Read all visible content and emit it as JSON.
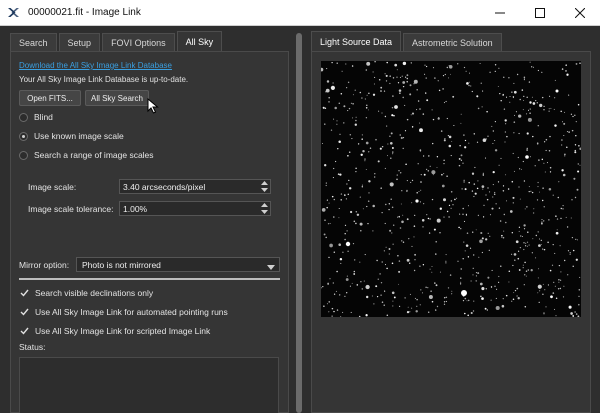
{
  "window": {
    "title": "00000021.fit - Image Link",
    "controls": [
      "—",
      "☐",
      "✕"
    ]
  },
  "left_tabs": [
    {
      "label": "Search",
      "active": false
    },
    {
      "label": "Setup",
      "active": false
    },
    {
      "label": "FOVI Options",
      "active": false
    },
    {
      "label": "All Sky",
      "active": true
    }
  ],
  "right_tabs": [
    {
      "label": "Light Source Data",
      "active": true
    },
    {
      "label": "Astrometric Solution",
      "active": false
    }
  ],
  "allsky": {
    "download_link": "Download the All Sky Image Link Database",
    "db_status": "Your All Sky Image Link Database is up-to-date.",
    "open_fits_button": "Open FITS...",
    "allsky_search_button": "All Sky Search"
  },
  "scale_mode": {
    "options": [
      {
        "label": "Blind",
        "checked": false
      },
      {
        "label": "Use known image scale",
        "checked": true
      },
      {
        "label": "Search a range of image scales",
        "checked": false
      }
    ]
  },
  "image_scale": {
    "label": "Image scale:",
    "value": "3.40 arcseconds/pixel"
  },
  "scale_tolerance": {
    "label": "Image scale tolerance:",
    "value": "1.00%"
  },
  "mirror": {
    "label": "Mirror option:",
    "value": "Photo is not mirrored"
  },
  "checks": [
    {
      "label": "Search visible declinations only",
      "checked": true
    },
    {
      "label": "Use All Sky Image Link for automated pointing runs",
      "checked": true
    },
    {
      "label": "Use All Sky Image Link for scripted Image Link",
      "checked": true
    }
  ],
  "status": {
    "label": "Status:",
    "text": ""
  },
  "colors": {
    "link": "#3a9fe0",
    "background": "#2e2e2e",
    "panel": "#353535"
  }
}
